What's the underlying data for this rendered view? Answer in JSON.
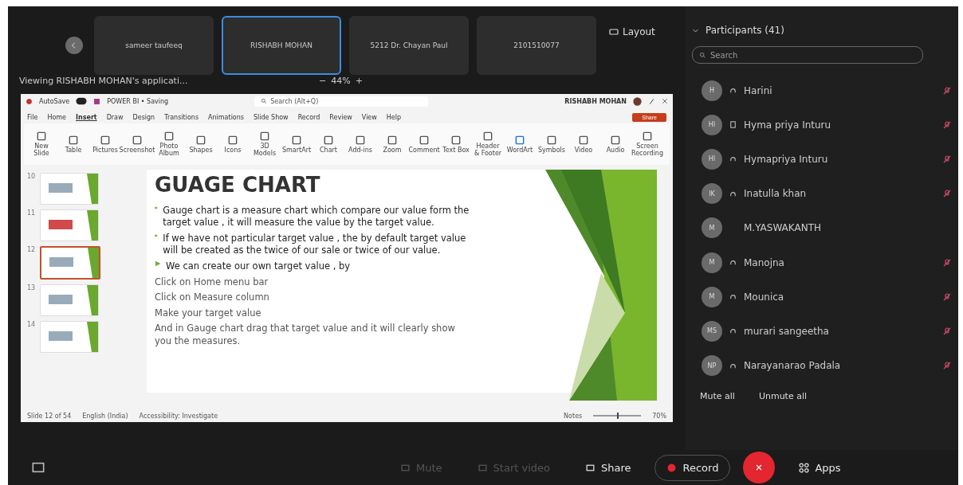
{
  "thumbnails": [
    {
      "name": "sameer taufeeq",
      "selected": false
    },
    {
      "name": "RISHABH MOHAN",
      "selected": true
    },
    {
      "name": "5212 Dr. Chayan Paul",
      "selected": false
    },
    {
      "name": "2101510077",
      "selected": false
    }
  ],
  "layout_button": "Layout",
  "share_bar": {
    "viewing": "Viewing RISHABH MOHAN's applicati...",
    "minus": "−",
    "zoom": "44%",
    "plus": "+"
  },
  "app": {
    "autosave": "AutoSave",
    "file_title": "POWER BI • Saving",
    "search": "Search (Alt+Q)",
    "user": "RISHABH MOHAN",
    "menu": [
      {
        "label": "File",
        "selected": false
      },
      {
        "label": "Home",
        "selected": false
      },
      {
        "label": "Insert",
        "selected": true
      },
      {
        "label": "Draw",
        "selected": false
      },
      {
        "label": "Design",
        "selected": false
      },
      {
        "label": "Transitions",
        "selected": false
      },
      {
        "label": "Animations",
        "selected": false
      },
      {
        "label": "Slide Show",
        "selected": false
      },
      {
        "label": "Record",
        "selected": false
      },
      {
        "label": "Review",
        "selected": false
      },
      {
        "label": "View",
        "selected": false
      },
      {
        "label": "Help",
        "selected": false
      }
    ],
    "share": "Share",
    "ribbon": [
      "New Slide",
      "Table",
      "Pictures",
      "Screenshot",
      "Photo Album",
      "Shapes",
      "Icons",
      "3D Models",
      "SmartArt",
      "Chart",
      "Add-ins",
      "Zoom",
      "Comment",
      "Text Box",
      "Header & Footer",
      "WordArt",
      "Symbols",
      "Video",
      "Audio",
      "Screen Recording"
    ],
    "slides": [
      {
        "number": "10",
        "selected": false
      },
      {
        "number": "11",
        "selected": false
      },
      {
        "number": "12",
        "selected": true
      },
      {
        "number": "13",
        "selected": false
      },
      {
        "number": "14",
        "selected": false
      }
    ],
    "slide": {
      "title": "GUAGE CHART",
      "bullets": [
        "Gauge chart is a measure chart which compare our value form the target value , it will measure the value by the target value.",
        "If we have not particular target value , the by default target value will be created as the twice of our sale or twice of our value.",
        "We can create our own target value , by"
      ],
      "steps": [
        "Click on Home menu bar",
        "Click on Measure column",
        "Make your target value",
        "And in Gauge chart drag that target value and it will clearly show you the measures."
      ]
    },
    "status": [
      "Slide 12 of 54",
      "English (India)",
      "Accessibility: Investigate"
    ],
    "notes": "Notes",
    "zoom": "70%",
    "zoom_slider": {
      "level": 0.5
    }
  },
  "participants": {
    "title": "Participants (41)",
    "search_placeholder": "Search",
    "list": [
      {
        "initials": "H",
        "name": "Harini",
        "kind": "audio",
        "muted": true
      },
      {
        "initials": "HI",
        "name": "Hyma priya Inturu",
        "kind": "phone",
        "muted": true
      },
      {
        "initials": "HI",
        "name": "Hymapriya Inturu",
        "kind": "audio",
        "muted": true
      },
      {
        "initials": "IK",
        "name": "Inatulla khan",
        "kind": "audio",
        "muted": true
      },
      {
        "initials": "M",
        "name": "M.YASWAKANTH",
        "kind": "plain",
        "muted": false
      },
      {
        "initials": "M",
        "name": "Manojna",
        "kind": "audio",
        "muted": true
      },
      {
        "initials": "M",
        "name": "Mounica",
        "kind": "audio",
        "muted": true
      },
      {
        "initials": "MS",
        "name": "murari sangeetha",
        "kind": "audio",
        "muted": true
      },
      {
        "initials": "NP",
        "name": "Narayanarao Padala",
        "kind": "audio",
        "muted": true
      }
    ],
    "mute_all": "Mute all",
    "unmute_all": "Unmute all"
  },
  "controls": [
    {
      "label": "Mute",
      "disabled": true
    },
    {
      "label": "Start video",
      "disabled": true
    },
    {
      "label": "Share",
      "disabled": false
    },
    {
      "label": "Record",
      "disabled": false
    }
  ],
  "apps": "Apps"
}
